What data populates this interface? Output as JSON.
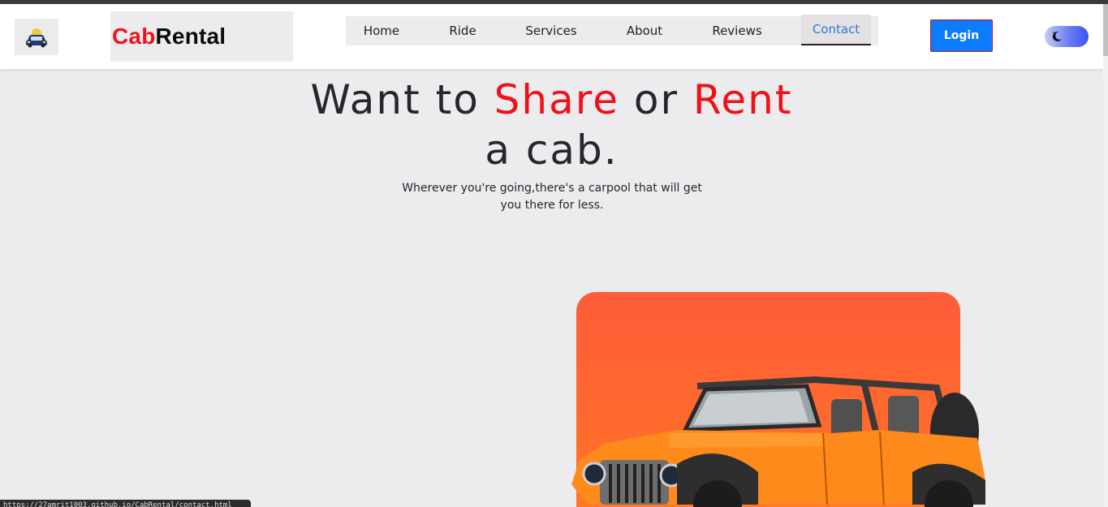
{
  "brand": {
    "part1": "Cab",
    "part2": "Rental"
  },
  "nav": {
    "items": [
      {
        "label": "Home"
      },
      {
        "label": "Ride"
      },
      {
        "label": "Services"
      },
      {
        "label": "About"
      },
      {
        "label": "Reviews"
      },
      {
        "label": "Contact"
      }
    ],
    "active": "Contact"
  },
  "login_label": "Login",
  "theme_toggle_icon": "moon-icon",
  "hero": {
    "line1_a": "Want to ",
    "line1_b": "Share",
    "line1_c": " or ",
    "line1_d": "Rent",
    "line2": "a cab.",
    "subtitle": "Wherever you're going,there's a carpool that will get you there for less."
  },
  "status_url": "https://27amrit1003.github.io/CabRental/contact.html",
  "colors": {
    "accent_red": "#f20f17",
    "login_blue": "#0b7bff",
    "card_orange": "#ff5c39",
    "active_nav": "#2f78d8"
  }
}
